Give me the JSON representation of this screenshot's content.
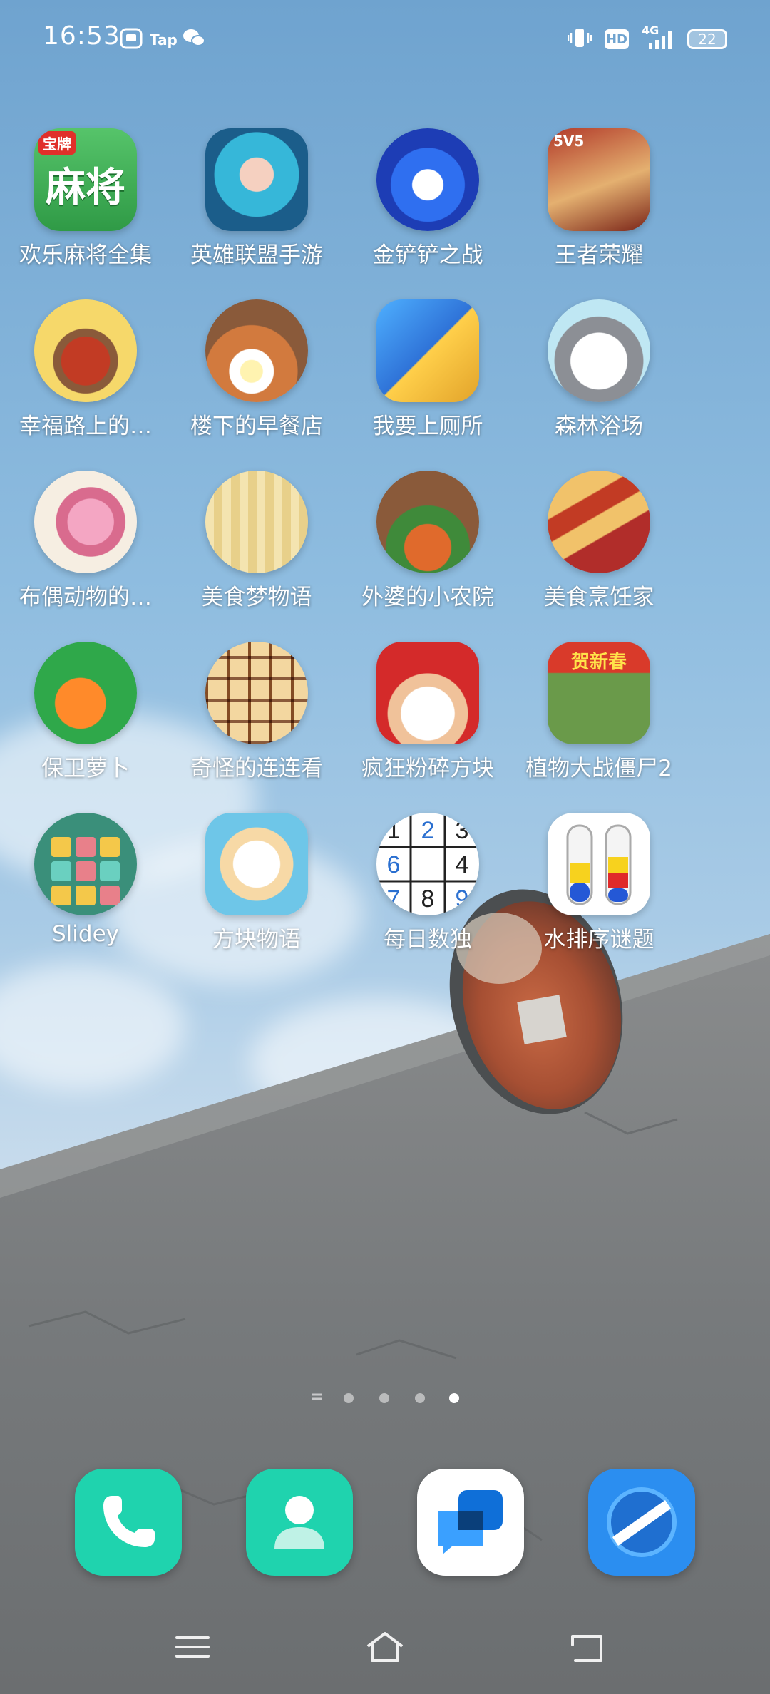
{
  "status_bar": {
    "time": "16:53",
    "tap_label": "Tap",
    "network": "4G",
    "hd_label": "HD",
    "battery": "22"
  },
  "apps": [
    {
      "label": "欢乐麻将全集",
      "icon": "mahjong-icon",
      "badge": "宝牌",
      "glyph": "麻将"
    },
    {
      "label": "英雄联盟手游",
      "icon": "league-of-legends-icon"
    },
    {
      "label": "金铲铲之战",
      "icon": "penguin-game-icon"
    },
    {
      "label": "王者荣耀",
      "icon": "honor-of-kings-icon",
      "badge": "5V5"
    },
    {
      "label": "幸福路上的…",
      "icon": "hotpot-icon"
    },
    {
      "label": "楼下的早餐店",
      "icon": "breakfast-dog-icon"
    },
    {
      "label": "我要上厕所",
      "icon": "toilet-game-icon"
    },
    {
      "label": "森林浴场",
      "icon": "cat-bath-icon"
    },
    {
      "label": "布偶动物的…",
      "icon": "plush-animal-icon"
    },
    {
      "label": "美食梦物语",
      "icon": "pixel-chef-icon"
    },
    {
      "label": "外婆的小农院",
      "icon": "grandma-farm-icon"
    },
    {
      "label": "美食烹饪家",
      "icon": "hotdog-icon"
    },
    {
      "label": "保卫萝卜",
      "icon": "carrot-icon"
    },
    {
      "label": "奇怪的连连看",
      "icon": "tile-match-icon"
    },
    {
      "label": "疯狂粉碎方块",
      "icon": "santa-icon"
    },
    {
      "label": "植物大战僵尸2",
      "icon": "pvz-zombie-icon",
      "badge": "贺新春"
    },
    {
      "label": "Slidey",
      "icon": "slidey-block-icon"
    },
    {
      "label": "方块物语",
      "icon": "cat-mahjong-icon"
    },
    {
      "label": "每日数独",
      "icon": "sudoku-icon",
      "digits": [
        "1",
        "2",
        "3",
        "6",
        "4",
        "7",
        "8",
        "9"
      ]
    },
    {
      "label": "水排序谜题",
      "icon": "water-sort-icon"
    }
  ],
  "dock": [
    {
      "name": "phone",
      "icon": "phone-icon"
    },
    {
      "name": "contacts",
      "icon": "contacts-icon"
    },
    {
      "name": "messages",
      "icon": "messages-icon"
    },
    {
      "name": "browser",
      "icon": "browser-icon"
    }
  ],
  "pages": {
    "count": 5,
    "active": 5
  },
  "colors": {
    "dock_teal": "#1fd3ae",
    "browser_blue": "#2b8ef0",
    "sky_top": "#6fa3cf",
    "wall_gray": "#7d7f80"
  }
}
